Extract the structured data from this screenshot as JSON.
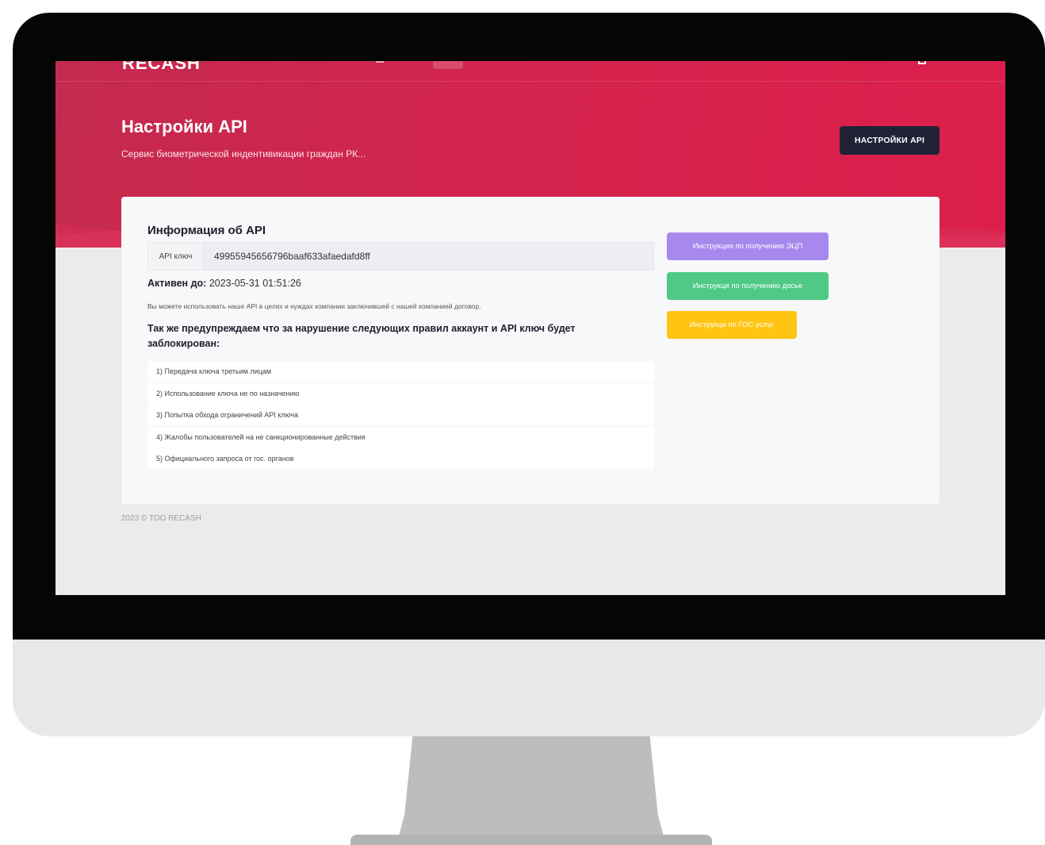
{
  "app": {
    "logo_text": "RECASH"
  },
  "header": {
    "title": "Настройки API",
    "subtitle": "Сервис биометрической индентивикации граждан РК...",
    "settings_button_label": "НАСТРОЙКИ API"
  },
  "card": {
    "title": "Информация об API",
    "api_key_label": "API ключ",
    "api_key_value": "49955945656796baaf633afaedafd8ff",
    "active_label": "Активен до:",
    "active_value": "2023-05-31 01:51:26",
    "note": "Вы можете использовать наше API в целях и нуждах компании заключившей с нашей компанией договор.",
    "warning": "Так же предупреждаем что за нарушение следующих правил аккаунт и API ключ будет заблокирован:",
    "rules": [
      "1) Передача ключа третьим лицам",
      "2) Использование ключа не по назначению",
      "3) Попытка обхода ограничений API ключа",
      "4) Жалобы пользователей на не санкционированные действия",
      "5) Официального запроса от гос. органов"
    ],
    "buttons": {
      "ecp": "Инструкция по получению ЭЦП",
      "dossier": "Инструкци по получению досье",
      "gov": "Инструкци по ГОС услуг"
    }
  },
  "footer": {
    "text": "2023 © ТОО RECASH"
  },
  "colors": {
    "hero": "#d3244d",
    "dark_button": "#1f2235",
    "purple": "#a789ee",
    "green": "#4fc985",
    "yellow": "#ffc512"
  }
}
